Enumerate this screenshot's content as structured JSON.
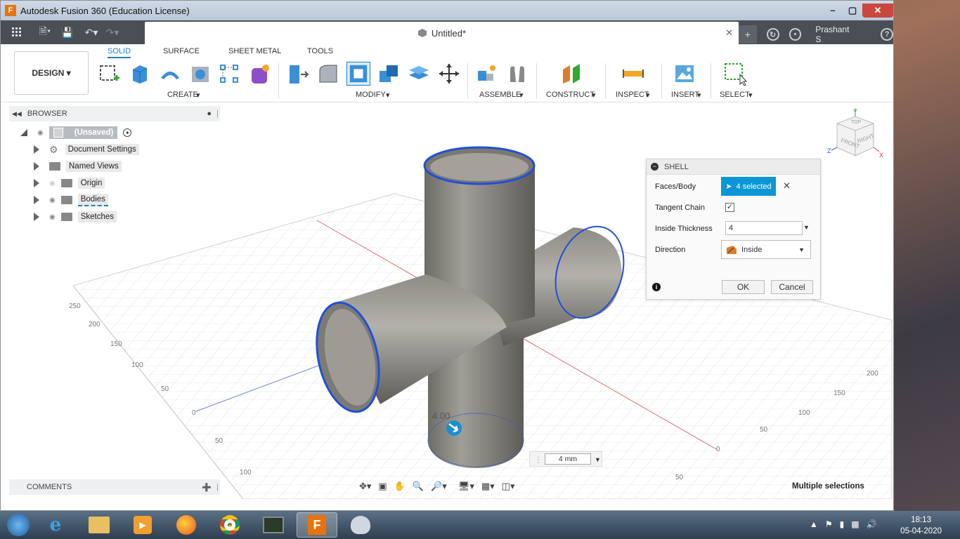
{
  "window": {
    "title": "Autodesk Fusion 360 (Education License)"
  },
  "document": {
    "tab_title": "Untitled*"
  },
  "user": {
    "name": "Prashant S"
  },
  "workspace": {
    "label": "DESIGN"
  },
  "ribbon": {
    "tabs": [
      "SOLID",
      "SURFACE",
      "SHEET METAL",
      "TOOLS"
    ],
    "groups": [
      "CREATE",
      "MODIFY",
      "ASSEMBLE",
      "CONSTRUCT",
      "INSPECT",
      "INSERT",
      "SELECT"
    ]
  },
  "browser": {
    "header": "BROWSER",
    "items": [
      {
        "label": "(Unsaved)"
      },
      {
        "label": "Document Settings"
      },
      {
        "label": "Named Views"
      },
      {
        "label": "Origin"
      },
      {
        "label": "Bodies"
      },
      {
        "label": "Sketches"
      }
    ]
  },
  "viewcube": {
    "front": "FRONT",
    "right": "RIGHT",
    "top": "TOP",
    "axes": [
      "Y",
      "Z",
      "X"
    ]
  },
  "grid_labels": [
    "250",
    "200",
    "150",
    "100",
    "50",
    "0",
    "50",
    "100",
    "0",
    "50",
    "100",
    "150",
    "200",
    "50"
  ],
  "shell": {
    "title": "SHELL",
    "faces_label": "Faces/Body",
    "selection": "4 selected",
    "tangent_label": "Tangent Chain",
    "tangent_checked": "✓",
    "thickness_label": "Inside Thickness",
    "thickness_value": "4",
    "direction_label": "Direction",
    "direction_value": "Inside",
    "ok": "OK",
    "cancel": "Cancel"
  },
  "viewport": {
    "dimension_label": "4.00",
    "dimension_input": "4 mm"
  },
  "comments": {
    "label": "COMMENTS"
  },
  "status": {
    "text": "Multiple selections"
  },
  "clock": {
    "time": "18:13",
    "date": "05-04-2020"
  },
  "colors": {
    "accent": "#0d96d6",
    "selection_edge": "#1f4fd8",
    "title_bar": "#c5d3e4",
    "toolbar_dark": "#4a4f55"
  }
}
